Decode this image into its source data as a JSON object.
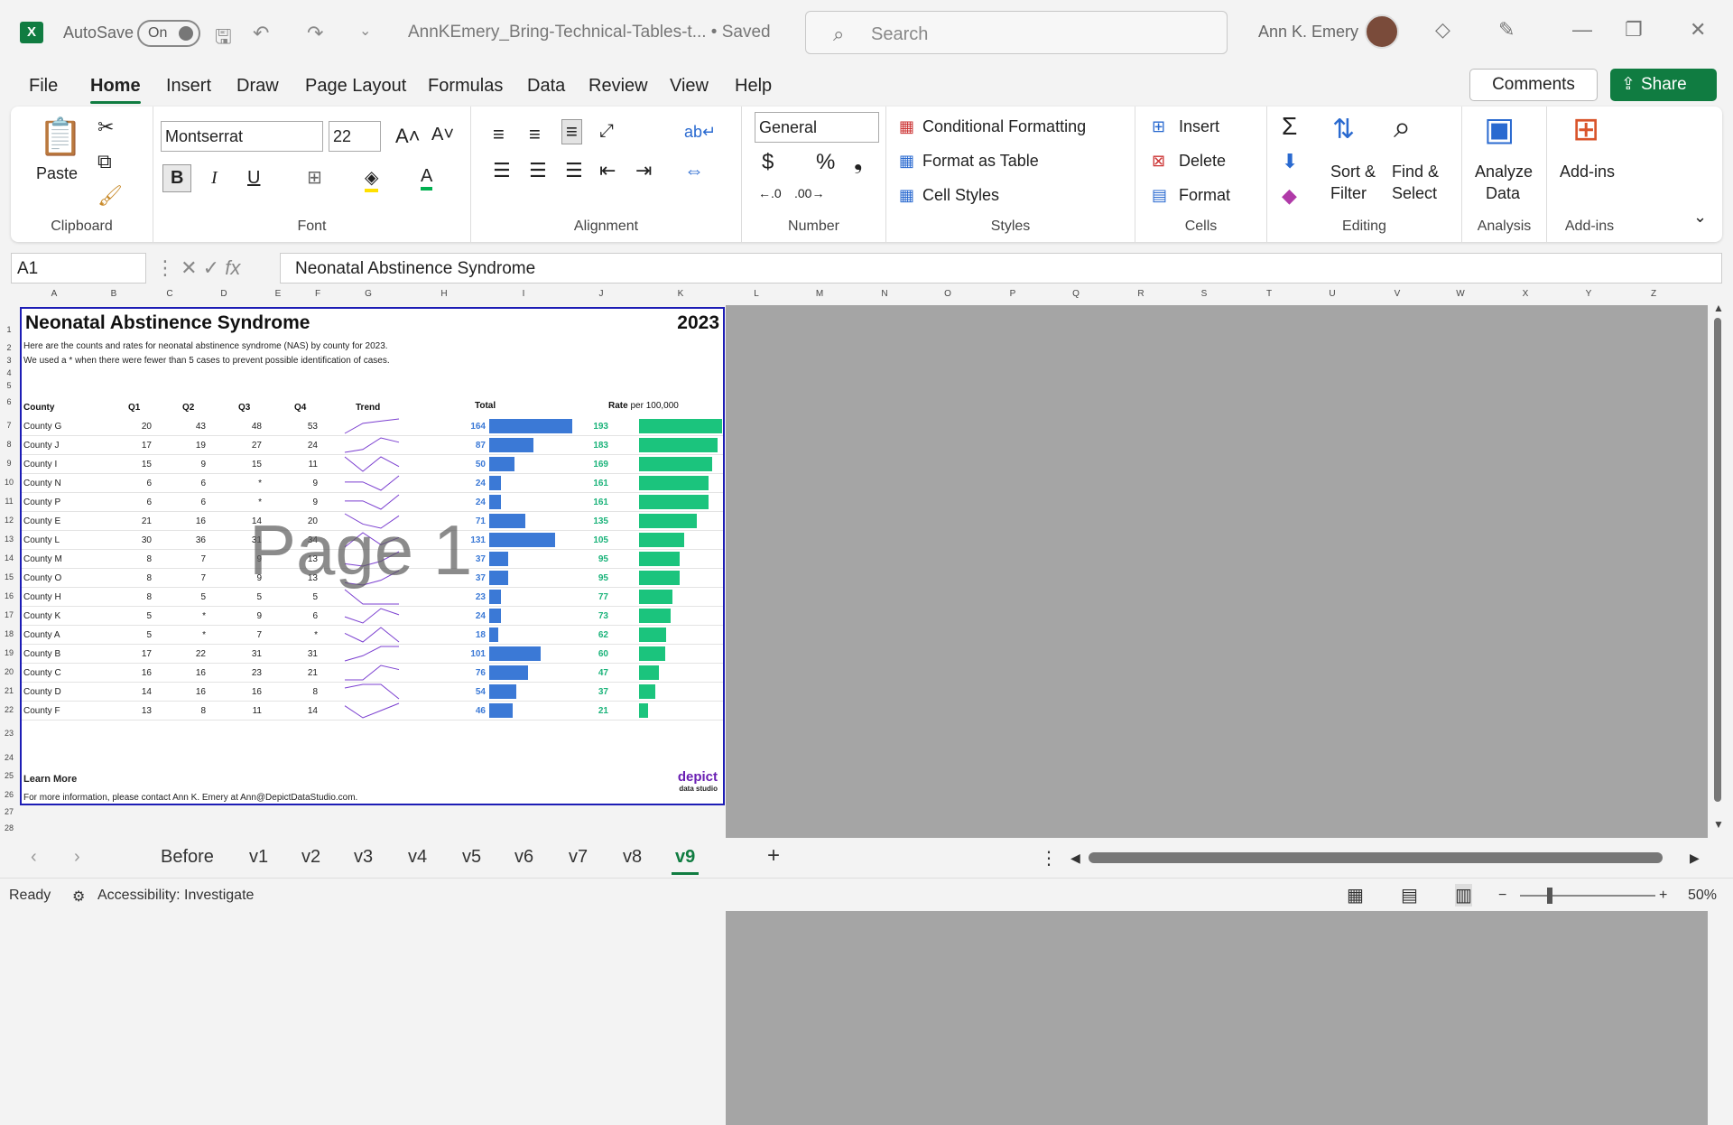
{
  "app": {
    "autosave_label": "AutoSave",
    "autosave_state": "On",
    "doc_title": "AnnKEmery_Bring-Technical-Tables-t...  •  Saved",
    "search_placeholder": "Search",
    "user_name": "Ann K. Emery"
  },
  "menu": [
    "File",
    "Home",
    "Insert",
    "Draw",
    "Page Layout",
    "Formulas",
    "Data",
    "Review",
    "View",
    "Help"
  ],
  "comments_label": "Comments",
  "share_label": "Share",
  "ribbon": {
    "clipboard": {
      "paste": "Paste",
      "label": "Clipboard"
    },
    "font": {
      "name": "Montserrat",
      "size": "22",
      "label": "Font"
    },
    "alignment": {
      "label": "Alignment"
    },
    "number": {
      "format": "General",
      "label": "Number"
    },
    "styles": {
      "cond": "Conditional Formatting",
      "table": "Format as Table",
      "cell": "Cell Styles",
      "label": "Styles"
    },
    "cells": {
      "insert": "Insert",
      "delete": "Delete",
      "format": "Format",
      "label": "Cells"
    },
    "editing": {
      "sort1": "Sort &",
      "sort2": "Filter",
      "find1": "Find &",
      "find2": "Select",
      "label": "Editing"
    },
    "analysis": {
      "a1": "Analyze",
      "a2": "Data",
      "label": "Analysis"
    },
    "addins": {
      "a1": "Add-ins",
      "label": "Add-ins"
    }
  },
  "formula_bar": {
    "cell": "A1",
    "content": "Neonatal Abstinence Syndrome"
  },
  "columns": [
    "A",
    "B",
    "C",
    "D",
    "E",
    "F",
    "G",
    "H",
    "I",
    "J",
    "K",
    "L",
    "M",
    "N",
    "O",
    "P",
    "Q",
    "R",
    "S",
    "T",
    "U",
    "V",
    "W",
    "X",
    "Y",
    "Z"
  ],
  "sheet": {
    "title": "Neonatal Abstinence Syndrome",
    "year": "2023",
    "sub1": "Here are the counts and rates for neonatal abstinence syndrome (NAS) by county for 2023.",
    "sub2": "We used a * when there were fewer than 5 cases to prevent possible identification of cases.",
    "headers": {
      "county": "County",
      "q1": "Q1",
      "q2": "Q2",
      "q3": "Q3",
      "q4": "Q4",
      "trend": "Trend",
      "total": "Total",
      "rate": "Rate",
      "rate_suffix": " per 100,000"
    },
    "watermark": "Page 1",
    "learn_more": "Learn More",
    "contact": "For more information, please contact Ann K. Emery at Ann@DepictDataStudio.com.",
    "logo_top": "depict",
    "logo_bottom": "data studio"
  },
  "chart_data": {
    "type": "table",
    "columns": [
      "County",
      "Q1",
      "Q2",
      "Q3",
      "Q4",
      "Total",
      "Rate per 100,000"
    ],
    "rows": [
      [
        "County G",
        "20",
        "43",
        "48",
        "53",
        "164",
        "193"
      ],
      [
        "County J",
        "17",
        "19",
        "27",
        "24",
        "87",
        "183"
      ],
      [
        "County I",
        "15",
        "9",
        "15",
        "11",
        "50",
        "169"
      ],
      [
        "County N",
        "6",
        "6",
        "*",
        "9",
        "24",
        "161"
      ],
      [
        "County P",
        "6",
        "6",
        "*",
        "9",
        "24",
        "161"
      ],
      [
        "County E",
        "21",
        "16",
        "14",
        "20",
        "71",
        "135"
      ],
      [
        "County L",
        "30",
        "36",
        "31",
        "34",
        "131",
        "105"
      ],
      [
        "County M",
        "8",
        "7",
        "9",
        "13",
        "37",
        "95"
      ],
      [
        "County O",
        "8",
        "7",
        "9",
        "13",
        "37",
        "95"
      ],
      [
        "County H",
        "8",
        "5",
        "5",
        "5",
        "23",
        "77"
      ],
      [
        "County K",
        "5",
        "*",
        "9",
        "6",
        "24",
        "73"
      ],
      [
        "County A",
        "5",
        "*",
        "7",
        "*",
        "18",
        "62"
      ],
      [
        "County B",
        "17",
        "22",
        "31",
        "31",
        "101",
        "60"
      ],
      [
        "County C",
        "16",
        "16",
        "23",
        "21",
        "76",
        "47"
      ],
      [
        "County D",
        "14",
        "16",
        "16",
        "8",
        "54",
        "37"
      ],
      [
        "County F",
        "13",
        "8",
        "11",
        "14",
        "46",
        "21"
      ]
    ],
    "total_max": 164,
    "rate_max": 193,
    "colors": {
      "total": "#3b79d6",
      "rate": "#1bc47d",
      "trend": "#7b3fd0"
    }
  },
  "tabs": [
    "Before",
    "v1",
    "v2",
    "v3",
    "v4",
    "v5",
    "v6",
    "v7",
    "v8",
    "v9"
  ],
  "active_tab": "v9",
  "status": {
    "ready": "Ready",
    "accessibility": "Accessibility: Investigate",
    "zoom": "50%"
  }
}
